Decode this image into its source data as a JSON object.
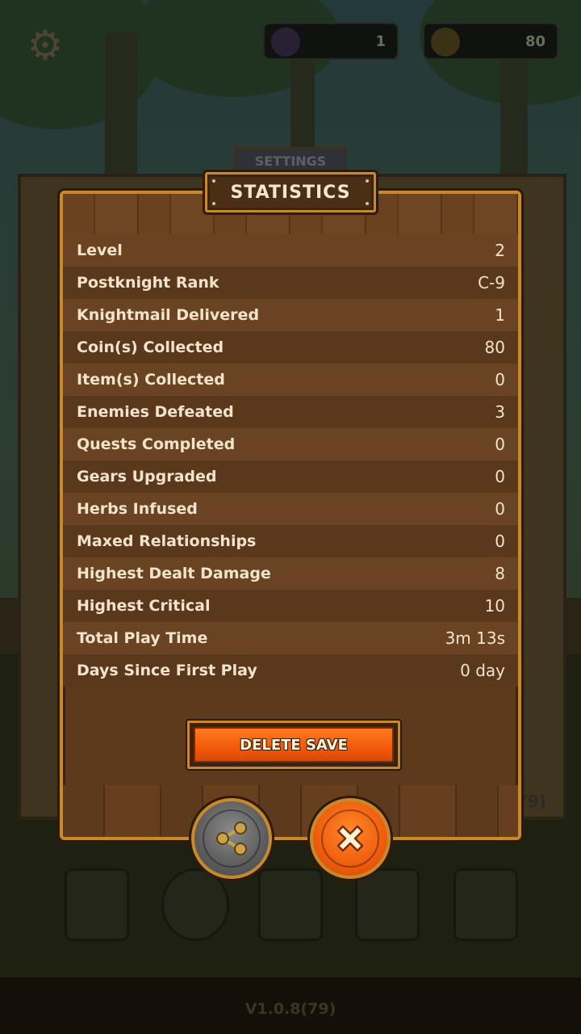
{
  "hud": {
    "gems_value": "1",
    "coins_value": "80"
  },
  "background": {
    "settings_tab_label": "SETTINGS",
    "side_version": "79)",
    "version_label": "V1.0.8(79)"
  },
  "statistics": {
    "title": "STATISTICS",
    "rows": [
      {
        "label": "Level",
        "value": "2"
      },
      {
        "label": "Postknight Rank",
        "value": "C-9"
      },
      {
        "label": "Knightmail Delivered",
        "value": "1"
      },
      {
        "label": "Coin(s) Collected",
        "value": "80"
      },
      {
        "label": "Item(s) Collected",
        "value": "0"
      },
      {
        "label": "Enemies Defeated",
        "value": "3"
      },
      {
        "label": "Quests Completed",
        "value": "0"
      },
      {
        "label": "Gears Upgraded",
        "value": "0"
      },
      {
        "label": "Herbs Infused",
        "value": "0"
      },
      {
        "label": "Maxed Relationships",
        "value": "0"
      },
      {
        "label": "Highest Dealt Damage",
        "value": "8"
      },
      {
        "label": "Highest Critical",
        "value": "10"
      },
      {
        "label": "Total Play Time",
        "value": "3m 13s"
      },
      {
        "label": "Days Since First Play",
        "value": "0 day"
      }
    ],
    "delete_label": "DELETE SAVE"
  },
  "icons": {
    "share": "share-icon",
    "close": "close-icon",
    "settings": "gear-icon",
    "gem": "gem-icon",
    "coin": "coin-icon"
  },
  "colors": {
    "panel_border": "#c9882a",
    "delete_button": "#f25a0a",
    "close_button": "#ef5c0c",
    "share_button": "#5c5c5c"
  }
}
